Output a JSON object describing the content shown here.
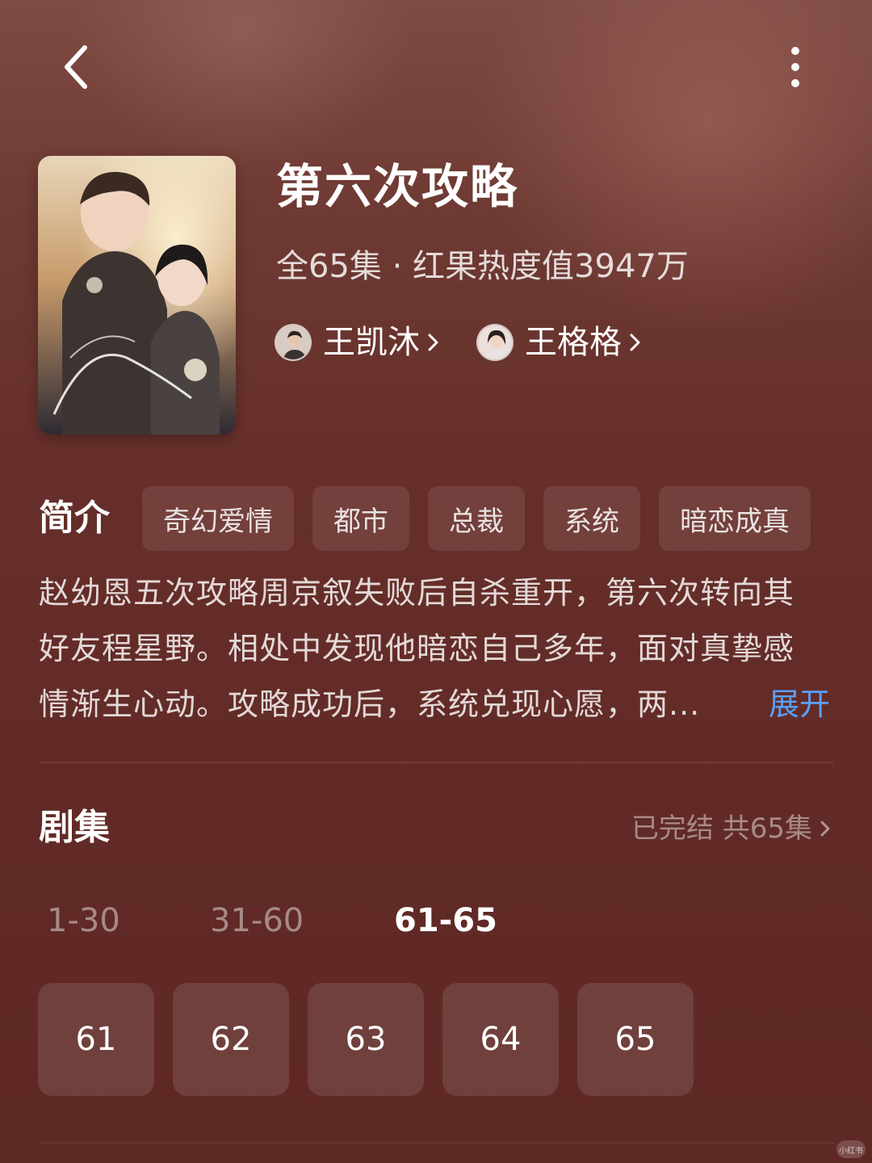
{
  "colors": {
    "background": "#652e29",
    "accent_link": "#5aa0ff",
    "text_primary": "#ffffff",
    "text_secondary": "#d9c3bf"
  },
  "topbar": {
    "back_icon": "back-arrow-icon",
    "more_icon": "more-vertical-icon"
  },
  "drama": {
    "title": "第六次攻略",
    "meta": "全65集 · 红果热度值3947万",
    "poster_icon": "drama-poster",
    "actors": [
      {
        "name": "王凯沐",
        "icon": "actor-avatar"
      },
      {
        "name": "王格格",
        "icon": "actor-avatar"
      }
    ]
  },
  "intro": {
    "heading": "简介",
    "tags": [
      "奇幻爱情",
      "都市",
      "总裁",
      "系统",
      "暗恋成真"
    ],
    "lines": [
      "赵幼恩五次攻略周京叙失败后自杀重开，第六次转向其",
      "好友程星野。相处中发现他暗恋自己多年，面对真挚感",
      "情渐生心动。攻略成功后，系统兑现心愿，两..."
    ],
    "expand_label": "展开"
  },
  "episodes": {
    "heading": "剧集",
    "status": "已完结 共65集",
    "ranges": [
      {
        "label": "1-30",
        "active": false
      },
      {
        "label": "31-60",
        "active": false
      },
      {
        "label": "61-65",
        "active": true
      }
    ],
    "items": [
      "61",
      "62",
      "63",
      "64",
      "65"
    ]
  },
  "watermark": "小红书"
}
